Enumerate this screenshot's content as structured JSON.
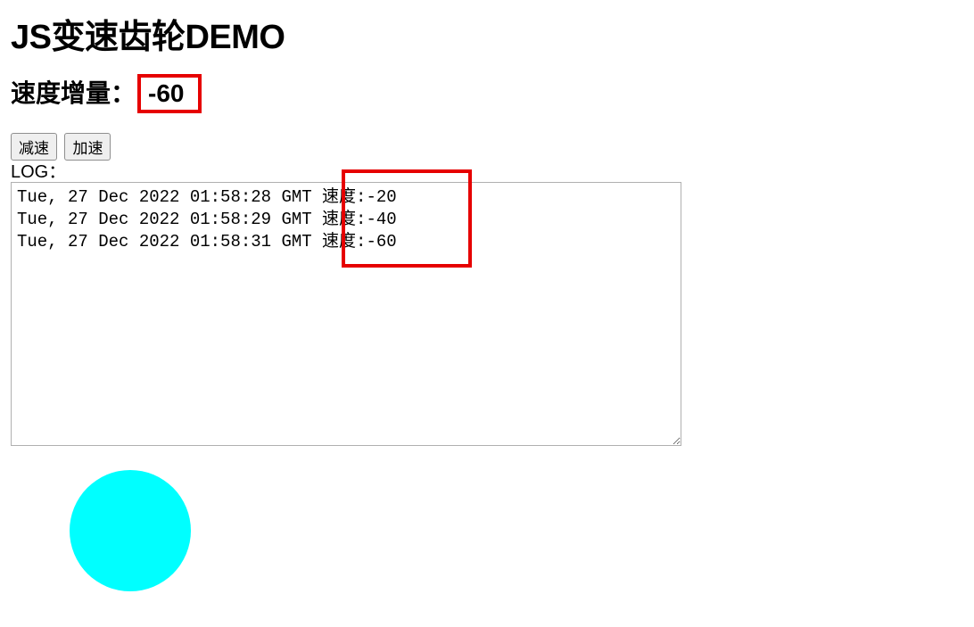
{
  "title": "JS变速齿轮DEMO",
  "speed_label": "速度增量：",
  "speed_value": "-60",
  "buttons": {
    "decel": "减速",
    "accel": "加速"
  },
  "log_label": "LOG：",
  "log_lines": [
    "Tue, 27 Dec 2022 01:58:28 GMT 速度:-20",
    "Tue, 27 Dec 2022 01:58:29 GMT 速度:-40",
    "Tue, 27 Dec 2022 01:58:31 GMT 速度:-60"
  ]
}
